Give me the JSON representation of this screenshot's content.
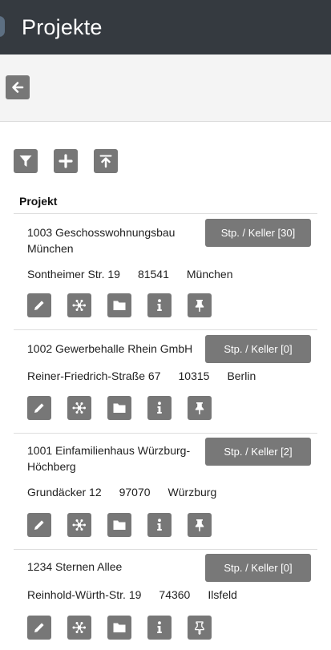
{
  "header": {
    "title": "Projekte"
  },
  "toolbar": {
    "back_icon": "arrow-left-icon",
    "filter_icon": "filter-icon",
    "add_icon": "plus-icon",
    "top_icon": "arrow-to-top-icon"
  },
  "table": {
    "column_header": "Projekt",
    "projects": [
      {
        "name": "1003 Geschosswohnungsbau München",
        "street": "Sontheimer Str. 19",
        "zip": "81541",
        "city": "München",
        "stp_label": "Stp. / Keller [30]",
        "pinned": true
      },
      {
        "name": "1002 Gewerbehalle Rhein GmbH",
        "street": "Reiner-Friedrich-Straße 67",
        "zip": "10315",
        "city": "Berlin",
        "stp_label": "Stp. / Keller [0]",
        "pinned": true
      },
      {
        "name": "1001 Einfamilienhaus Würzburg-Höchberg",
        "street": "Grundäcker 12",
        "zip": "97070",
        "city": "Würzburg",
        "stp_label": "Stp. / Keller [2]",
        "pinned": true
      },
      {
        "name": "1234 Sternen Allee",
        "street": "Reinhold-Würth-Str. 19",
        "zip": "74360",
        "city": "Ilsfeld",
        "stp_label": "Stp. / Keller [0]",
        "pinned": false
      }
    ]
  },
  "row_actions": [
    "pencil-icon",
    "network-icon",
    "folder-icon",
    "info-icon",
    "pin-icon"
  ],
  "colors": {
    "header_bg": "#353a40",
    "button_bg": "#777777",
    "subbar_bg": "#f4f4f4"
  }
}
